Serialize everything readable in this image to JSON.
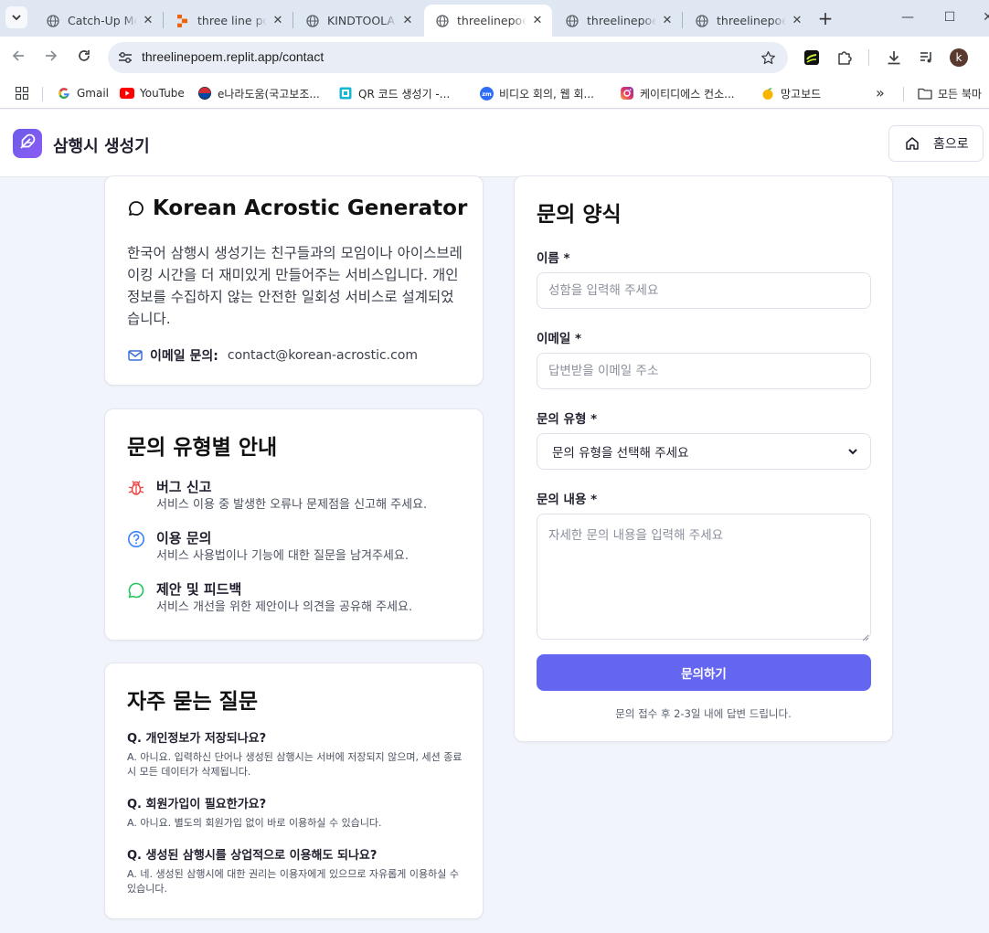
{
  "browser": {
    "tabs": [
      {
        "title": "Catch-Up Me",
        "icon": "globe-icon"
      },
      {
        "title": "three line po",
        "icon": "replit-icon"
      },
      {
        "title": "KINDTOOLAI",
        "icon": "globe-icon"
      },
      {
        "title": "threelinepoe",
        "icon": "globe-icon",
        "active": true
      },
      {
        "title": "threelinepoem",
        "icon": "globe-icon"
      },
      {
        "title": "threelinepoe",
        "icon": "globe-icon"
      }
    ],
    "url": "threelinepoem.replit.app/contact",
    "profile_initial": "k",
    "bookmarks": [
      {
        "label": "Gmail",
        "icon": "google-icon"
      },
      {
        "label": "YouTube",
        "icon": "youtube-icon"
      },
      {
        "label": "e나라도움(국고보조...",
        "icon": "enara-icon"
      },
      {
        "label": "QR 코드 생성기 -...",
        "icon": "qr-icon"
      },
      {
        "label": "비디오 회의, 웹 회...",
        "icon": "zoom-icon"
      },
      {
        "label": "케이티디에스 컨소...",
        "icon": "instagram-icon"
      },
      {
        "label": "망고보드",
        "icon": "mango-icon"
      }
    ],
    "all_bookmarks": "모든 북마"
  },
  "header": {
    "brand": "삼행시 생성기",
    "home_button": "홈으로"
  },
  "intro": {
    "title": "Korean Acrostic Generator",
    "description": "한국어 삼행시 생성기는 친구들과의 모임이나 아이스브레이킹 시간을 더 재미있게 만들어주는 서비스입니다. 개인정보를 수집하지 않는 안전한 일회성 서비스로 설계되었습니다.",
    "email_label": "이메일 문의:",
    "email_value": "contact@korean-acrostic.com"
  },
  "types": {
    "title": "문의 유형별 안내",
    "items": [
      {
        "title": "버그 신고",
        "desc": "서비스 이용 중 발생한 오류나 문제점을 신고해 주세요.",
        "icon": "bug-icon",
        "color": "#ef4444"
      },
      {
        "title": "이용 문의",
        "desc": "서비스 사용법이나 기능에 대한 질문을 남겨주세요.",
        "icon": "help-circle-icon",
        "color": "#3b82f6"
      },
      {
        "title": "제안 및 피드백",
        "desc": "서비스 개선을 위한 제안이나 의견을 공유해 주세요.",
        "icon": "message-circle-icon",
        "color": "#22c55e"
      }
    ]
  },
  "faq": {
    "title": "자주 묻는 질문",
    "items": [
      {
        "q": "Q. 개인정보가 저장되나요?",
        "a": "A. 아니요. 입력하신 단어나 생성된 삼행시는 서버에 저장되지 않으며, 세션 종료 시 모든 데이터가 삭제됩니다."
      },
      {
        "q": "Q. 회원가입이 필요한가요?",
        "a": "A. 아니요. 별도의 회원가입 없이 바로 이용하실 수 있습니다."
      },
      {
        "q": "Q. 생성된 삼행시를 상업적으로 이용해도 되나요?",
        "a": "A. 네. 생성된 삼행시에 대한 권리는 이용자에게 있으므로 자유롭게 이용하실 수 있습니다."
      }
    ]
  },
  "form": {
    "title": "문의 양식",
    "name_label": "이름 *",
    "name_placeholder": "성함을 입력해 주세요",
    "email_label": "이메일 *",
    "email_placeholder": "답변받을 이메일 주소",
    "type_label": "문의 유형 *",
    "type_selected": "문의 유형을 선택해 주세요",
    "content_label": "문의 내용 *",
    "content_placeholder": "자세한 문의 내용을 입력해 주세요",
    "submit_label": "문의하기",
    "note": "문의 접수 후 2-3일 내에 답변 드립니다."
  },
  "colors": {
    "accent": "#6466f1",
    "brand_gradient_start": "#6c5ce7",
    "page_bg": "#f1f4fa"
  }
}
